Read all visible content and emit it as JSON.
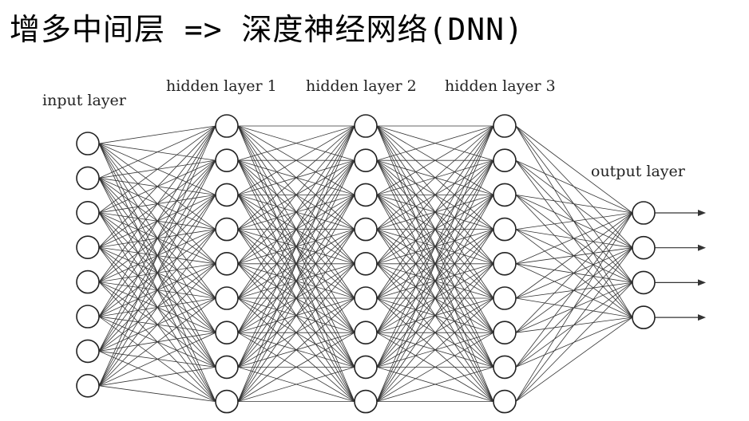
{
  "title": "增多中间层 => 深度神经网络(DNN)",
  "diagram": {
    "layers": [
      {
        "label": "input layer",
        "nodes": 8
      },
      {
        "label": "hidden layer 1",
        "nodes": 9
      },
      {
        "label": "hidden layer 2",
        "nodes": 9
      },
      {
        "label": "hidden layer 3",
        "nodes": 9
      },
      {
        "label": "output layer",
        "nodes": 4
      }
    ],
    "output_arrows": true
  }
}
